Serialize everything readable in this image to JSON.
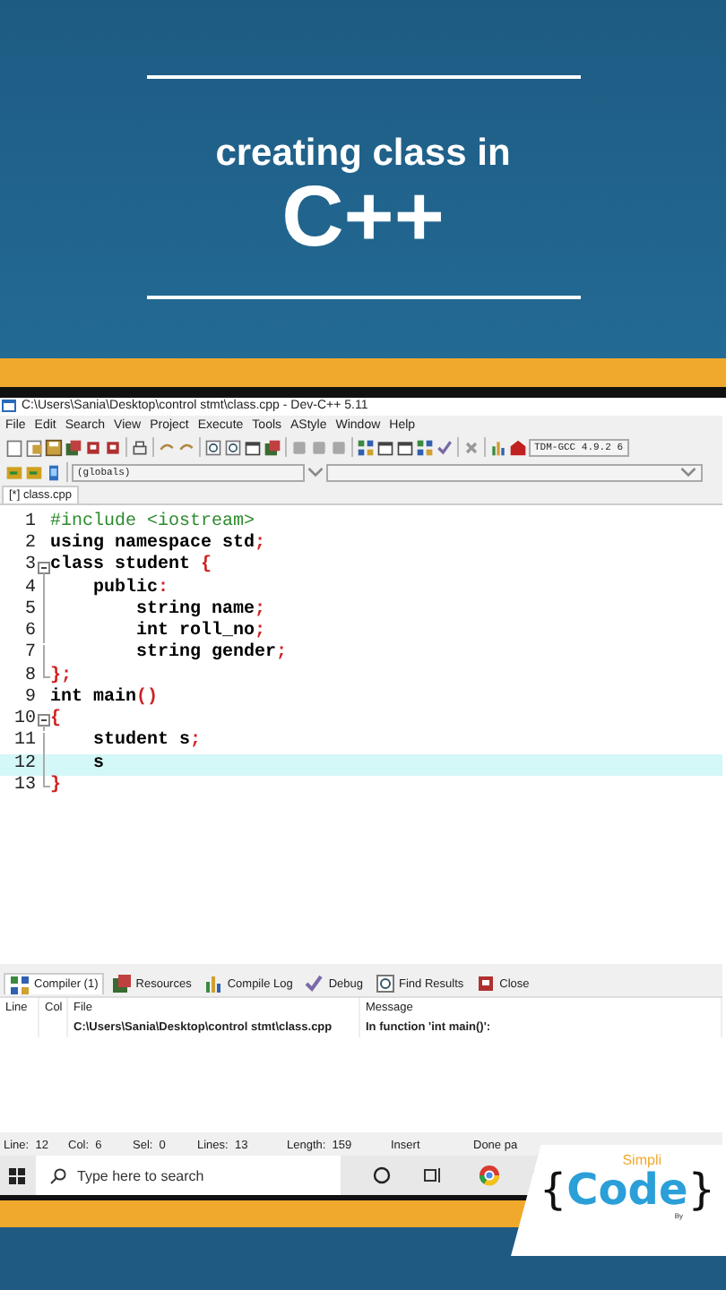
{
  "banner": {
    "subtitle": "creating class in",
    "title": "C++"
  },
  "window": {
    "title": "C:\\Users\\Sania\\Desktop\\control stmt\\class.cpp - Dev-C++ 5.11"
  },
  "menu": [
    "File",
    "Edit",
    "Search",
    "View",
    "Project",
    "Execute",
    "Tools",
    "AStyle",
    "Window",
    "Help"
  ],
  "compiler_select": {
    "value": "TDM-GCC 4.9.2 6"
  },
  "scope_select": {
    "value": "(globals)"
  },
  "file_tabs": [
    {
      "label": "[*] class.cpp",
      "selected": true
    }
  ],
  "editor": {
    "lines": [
      {
        "number": "1",
        "kind": "plain",
        "current": false,
        "tokens": [
          {
            "t": "#include <iostream>",
            "kind": "preprocessor"
          }
        ]
      },
      {
        "number": "2",
        "kind": "plain",
        "current": false,
        "tokens": [
          {
            "t": "using namespace std",
            "kind": "keyword"
          },
          {
            "t": ";",
            "kind": "symbol"
          }
        ]
      },
      {
        "number": "3",
        "kind": "open",
        "current": false,
        "tokens": [
          {
            "t": "class student ",
            "kind": "keyword"
          },
          {
            "t": "{",
            "kind": "symbol"
          }
        ]
      },
      {
        "number": "4",
        "kind": "inside",
        "current": false,
        "tokens": [
          {
            "t": "    public",
            "kind": "keyword"
          },
          {
            "t": ":",
            "kind": "symbol"
          }
        ]
      },
      {
        "number": "5",
        "kind": "inside",
        "current": false,
        "tokens": [
          {
            "t": "        string name",
            "kind": "keyword"
          },
          {
            "t": ";",
            "kind": "symbol"
          }
        ]
      },
      {
        "number": "6",
        "kind": "inside",
        "current": false,
        "tokens": [
          {
            "t": "        int roll_no",
            "kind": "keyword"
          },
          {
            "t": ";",
            "kind": "symbol"
          }
        ]
      },
      {
        "number": "7",
        "kind": "inside",
        "current": false,
        "tokens": [
          {
            "t": "        string gender",
            "kind": "keyword"
          },
          {
            "t": ";",
            "kind": "symbol"
          }
        ]
      },
      {
        "number": "8",
        "kind": "end",
        "current": false,
        "tokens": [
          {
            "t": "};",
            "kind": "symbol"
          }
        ]
      },
      {
        "number": "9",
        "kind": "plain",
        "current": false,
        "tokens": [
          {
            "t": "int main",
            "kind": "keyword"
          },
          {
            "t": "()",
            "kind": "symbol"
          }
        ]
      },
      {
        "number": "10",
        "kind": "open",
        "current": false,
        "tokens": [
          {
            "t": "{",
            "kind": "symbol"
          }
        ]
      },
      {
        "number": "11",
        "kind": "inside",
        "current": false,
        "tokens": [
          {
            "t": "    student s",
            "kind": "keyword"
          },
          {
            "t": ";",
            "kind": "symbol"
          }
        ]
      },
      {
        "number": "12",
        "kind": "inside",
        "current": true,
        "tokens": [
          {
            "t": "    s",
            "kind": "keyword"
          }
        ]
      },
      {
        "number": "13",
        "kind": "end",
        "current": false,
        "tokens": [
          {
            "t": "}",
            "kind": "symbol"
          }
        ]
      }
    ]
  },
  "panel_tabs": [
    {
      "label": "Compiler (1)",
      "selected": true
    },
    {
      "label": "Resources",
      "selected": false
    },
    {
      "label": "Compile Log",
      "selected": false
    },
    {
      "label": "Debug",
      "selected": false
    },
    {
      "label": "Find Results",
      "selected": false
    },
    {
      "label": "Close",
      "selected": false
    }
  ],
  "messages": {
    "columns": [
      "Line",
      "Col",
      "File",
      "Message"
    ],
    "rows": [
      {
        "file": "C:\\Users\\Sania\\Desktop\\control stmt\\class.cpp",
        "message": "In function 'int main()':"
      }
    ]
  },
  "status_bar": [
    "Line:  12",
    "Col:  6",
    "Sel:  0",
    "Lines:  13",
    "Length:  159",
    "Insert",
    "Done pa"
  ],
  "taskbar": {
    "search": {
      "placeholder": "Type here to search"
    }
  },
  "logo": {
    "top": "Simpli",
    "open": "{",
    "word": "Code",
    "close": "}",
    "byline": "By"
  }
}
